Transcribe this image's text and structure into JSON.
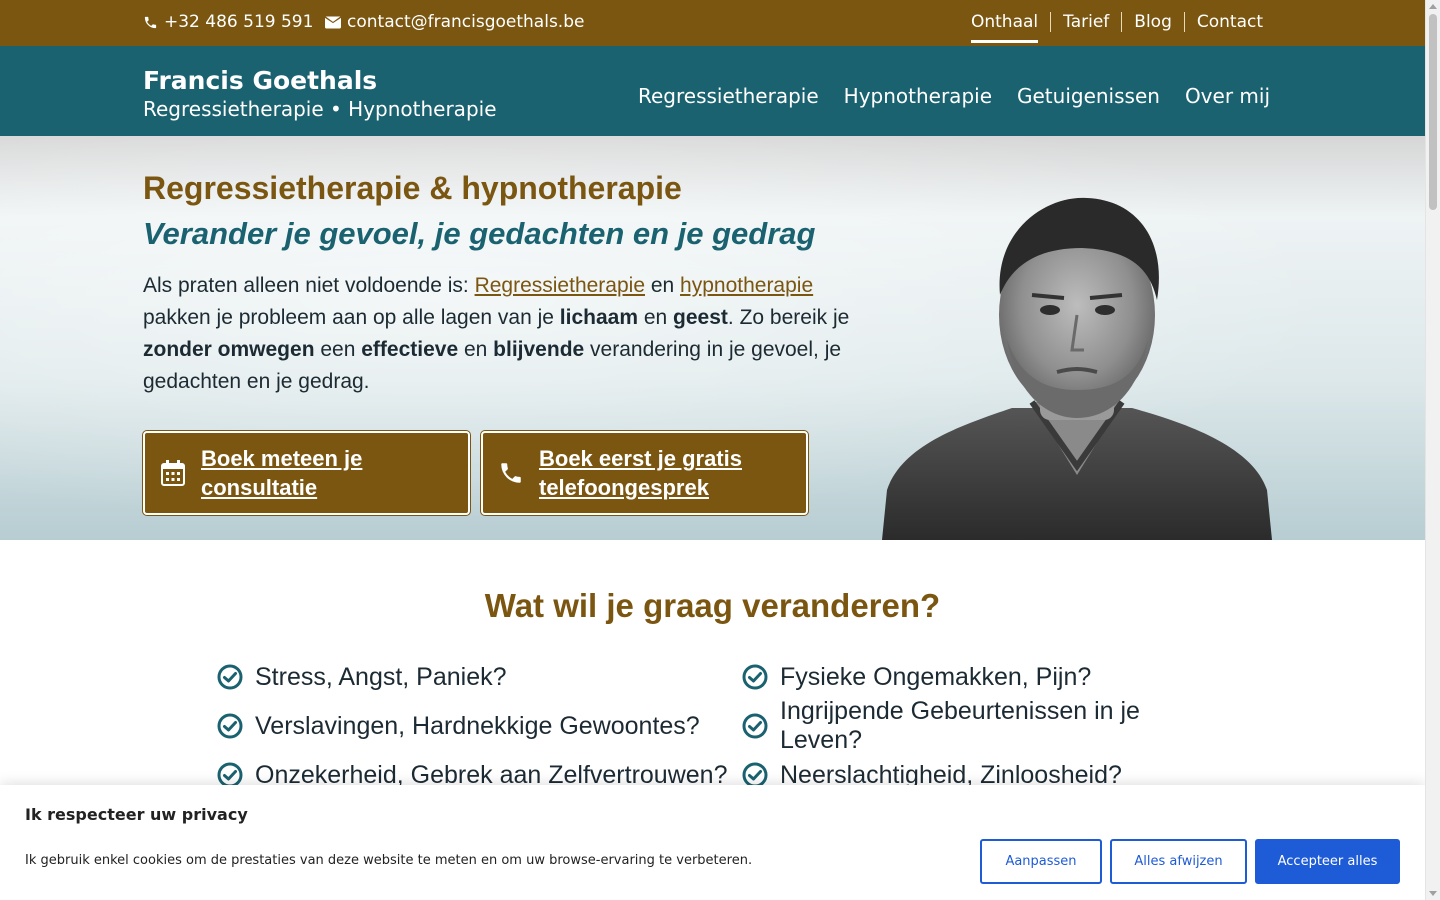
{
  "topbar": {
    "phone": "+32 486 519 591",
    "email": "contact@francisgoethals.be",
    "nav": [
      {
        "label": "Onthaal",
        "active": true
      },
      {
        "label": "Tarief"
      },
      {
        "label": "Blog"
      },
      {
        "label": "Contact"
      }
    ]
  },
  "header": {
    "brand_name": "Francis Goethals",
    "brand_sub": "Regressietherapie • Hypnotherapie",
    "nav": [
      "Regressietherapie",
      "Hypnotherapie",
      "Getuigenissen",
      "Over mij"
    ]
  },
  "hero": {
    "title": "Regressietherapie & hypnotherapie",
    "tagline": "Verander je gevoel, je gedachten en je gedrag",
    "text": {
      "p1": "Als praten alleen niet voldoende is: ",
      "link1": "Regressietherapie",
      "p2": " en ",
      "link2": "hypnotherapie",
      "p3": " pakken je probleem aan op alle lagen van je ",
      "b1": "lichaam",
      "p4": " en ",
      "b2": "geest",
      "p5": ". Zo bereik je ",
      "b3": "zonder omwegen",
      "p6": " een ",
      "b4": "effectieve",
      "p7": " en ",
      "b5": "blijvende",
      "p8": " verandering in je gevoel, je gedachten en je gedrag."
    },
    "cta_book": "Boek meteen je consultatie",
    "cta_call": "Boek eerst je gratis telefoongesprek"
  },
  "section": {
    "title": "Wat wil je graag veranderen?",
    "items": [
      "Stress, Angst, Paniek?",
      "Fysieke Ongemakken, Pijn?",
      "Verslavingen, Hardnekkige Gewoontes?",
      "Ingrijpende Gebeurtenissen in je Leven?",
      "Onzekerheid, Gebrek aan Zelfvertrouwen?",
      "Neerslachtigheid, Zinloosheid?"
    ]
  },
  "cookie": {
    "title": "Ik respecteer uw privacy",
    "text": "Ik gebruik enkel cookies om de prestaties van deze website te meten en om uw browse-ervaring te verbeteren.",
    "btn_customize": "Aanpassen",
    "btn_reject": "Alles afwijzen",
    "btn_accept": "Accepteer alles"
  },
  "colors": {
    "brown": "#7b5611",
    "teal": "#1a6270",
    "cookie_blue": "#1e5bd6"
  }
}
